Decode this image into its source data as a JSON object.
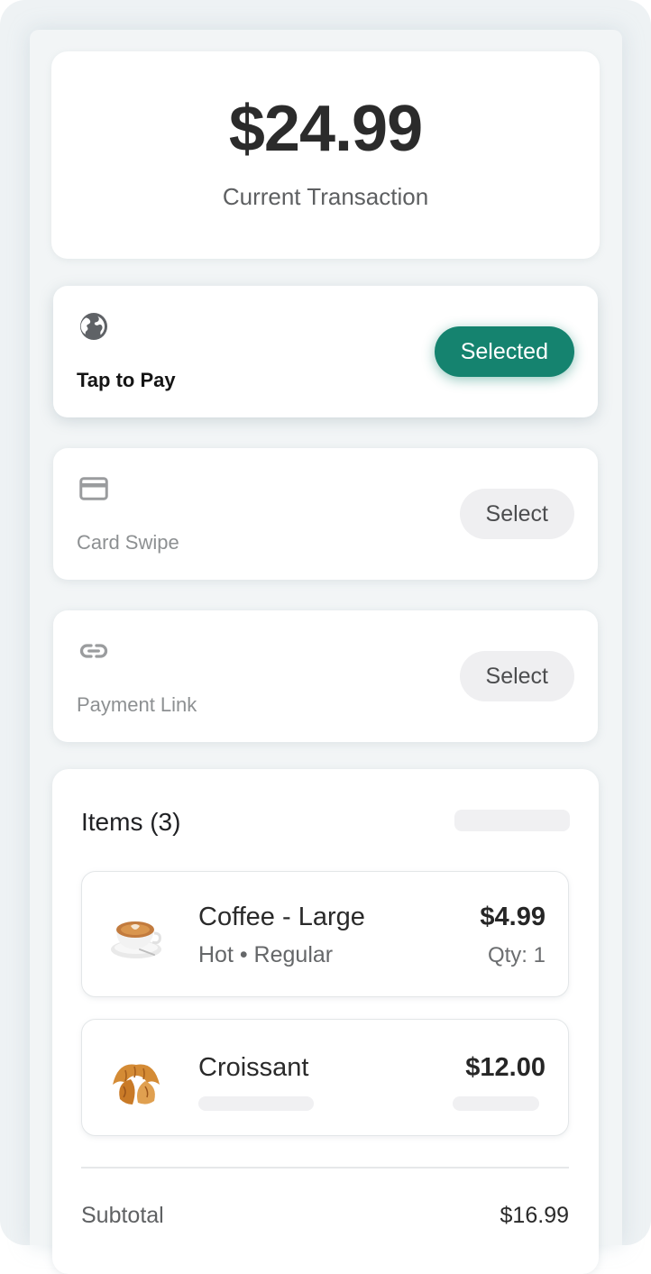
{
  "transaction": {
    "amount": "$24.99",
    "label": "Current Transaction"
  },
  "payment_methods": [
    {
      "label": "Tap to Pay",
      "icon": "globe-icon",
      "button": "Selected",
      "selected": true
    },
    {
      "label": "Card Swipe",
      "icon": "credit-card-icon",
      "button": "Select",
      "selected": false
    },
    {
      "label": "Payment Link",
      "icon": "link-icon",
      "button": "Select",
      "selected": false
    }
  ],
  "items": {
    "title": "Items (3)",
    "list": [
      {
        "name": "Coffee - Large",
        "details": "Hot • Regular",
        "price": "$4.99",
        "qty": "Qty: 1",
        "icon": "coffee-cup-icon"
      },
      {
        "name": "Croissant",
        "price": "$12.00",
        "icon": "croissant-icon"
      }
    ],
    "subtotal_label": "Subtotal",
    "subtotal_value": "$16.99"
  },
  "colors": {
    "accent": "#15836f",
    "background": "#eef2f4",
    "card": "#ffffff"
  }
}
